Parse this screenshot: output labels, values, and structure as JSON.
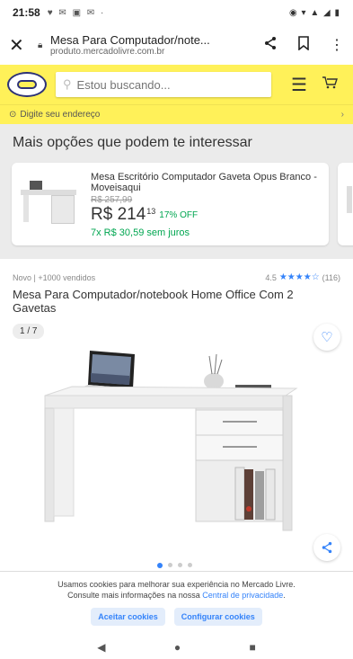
{
  "status": {
    "time": "21:58",
    "notifications": "♥ ✉ ▣ ✉ ·",
    "system_icons": "◉ ▾ ▲ ◢ ▮"
  },
  "browser": {
    "page_title": "Mesa Para Computador/note...",
    "url": "produto.mercadolivre.com.br"
  },
  "header": {
    "search_placeholder": "Estou buscando..."
  },
  "address": {
    "label": "Digite seu endereço"
  },
  "more_options": {
    "title": "Mais opções que podem te interessar",
    "card": {
      "name": "Mesa Escritório Computador Gaveta Opus Branco - Moveisaqui",
      "old_price": "R$ 257,99",
      "price": "R$ 214",
      "cents": "13",
      "discount": "17% OFF",
      "installments": "7x R$ 30,59 sem juros"
    }
  },
  "product": {
    "meta": "Novo  |  +1000 vendidos",
    "rating": "4.5",
    "stars": "★★★★☆",
    "reviews": "(116)",
    "title": "Mesa Para Computador/notebook Home Office Com 2 Gavetas",
    "counter": "1 / 7"
  },
  "cookie": {
    "text_line1": "Usamos cookies para melhorar sua experiência no Mercado Livre.",
    "text_line2": "Consulte mais informações na nossa",
    "link": "Central de privacidade",
    "accept": "Aceitar cookies",
    "configure": "Configurar cookies"
  },
  "nav": {
    "back": "◀",
    "home": "●",
    "recents": "■"
  },
  "colors": {
    "brand_yellow": "#fff159",
    "accent_blue": "#3483fa",
    "green": "#00a650"
  }
}
